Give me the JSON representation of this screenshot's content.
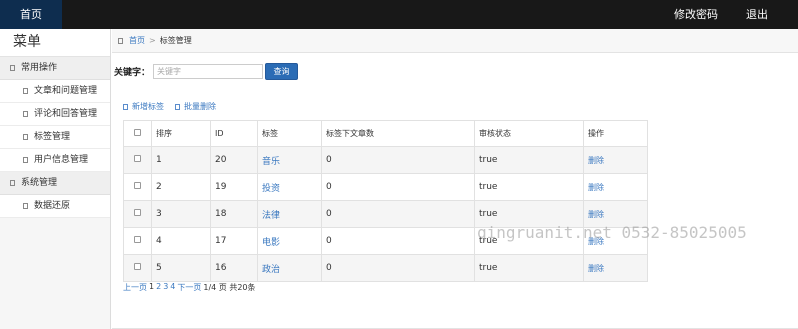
{
  "topnav": {
    "home": "首页",
    "change_password": "修改密码",
    "logout": "退出"
  },
  "sidebar": {
    "title": "菜单",
    "groups": [
      {
        "label": "常用操作",
        "items": [
          "文章和问题管理",
          "评论和回答管理",
          "标签管理",
          "用户信息管理"
        ]
      },
      {
        "label": "系统管理",
        "items": [
          "数据还原"
        ]
      }
    ]
  },
  "breadcrumb": {
    "home": "首页",
    "current": "标签管理"
  },
  "search": {
    "label": "关键字：",
    "placeholder": "关键字",
    "value": "",
    "button": "查询"
  },
  "actions": {
    "add": "新增标签",
    "bulk_delete": "批量删除"
  },
  "table": {
    "headers": [
      "排序",
      "ID",
      "标签",
      "标签下文章数",
      "审核状态",
      "操作"
    ],
    "rows": [
      {
        "order": "1",
        "id": "20",
        "tag": "音乐",
        "count": "0",
        "status": "true",
        "op": "删除"
      },
      {
        "order": "2",
        "id": "19",
        "tag": "投资",
        "count": "0",
        "status": "true",
        "op": "删除"
      },
      {
        "order": "3",
        "id": "18",
        "tag": "法律",
        "count": "0",
        "status": "true",
        "op": "删除"
      },
      {
        "order": "4",
        "id": "17",
        "tag": "电影",
        "count": "0",
        "status": "true",
        "op": "删除"
      },
      {
        "order": "5",
        "id": "16",
        "tag": "政治",
        "count": "0",
        "status": "true",
        "op": "删除"
      }
    ]
  },
  "pager": {
    "prev": "上一页",
    "pages": [
      "1",
      "2",
      "3",
      "4"
    ],
    "next": "下一页",
    "info": "1/4 页 共20条"
  },
  "watermark": "qingruanit.net 0532-85025005"
}
